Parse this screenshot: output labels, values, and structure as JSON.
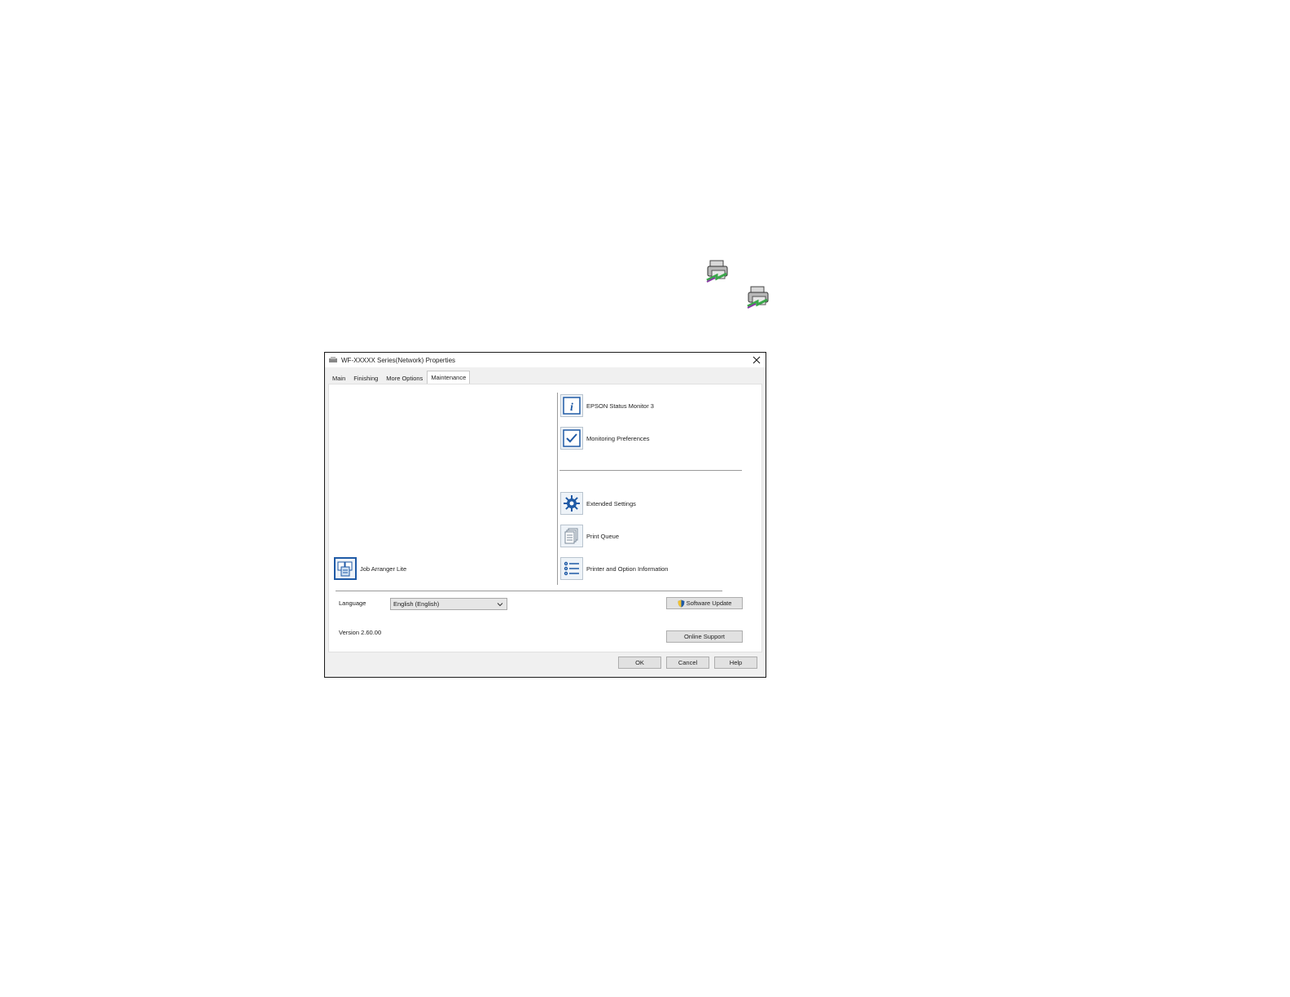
{
  "window": {
    "title": "WF-XXXXX Series(Network) Properties"
  },
  "tabs": [
    {
      "label": "Main"
    },
    {
      "label": "Finishing"
    },
    {
      "label": "More Options"
    },
    {
      "label": "Maintenance",
      "active": true
    }
  ],
  "utilities": {
    "status_monitor": {
      "label": "EPSON Status Monitor 3",
      "icon": "info-icon"
    },
    "monitoring_preferences": {
      "label": "Monitoring Preferences",
      "icon": "checkmark-icon"
    },
    "extended_settings": {
      "label": "Extended Settings",
      "icon": "gear-icon"
    },
    "print_queue": {
      "label": "Print Queue",
      "icon": "document-stack-icon"
    },
    "printer_info": {
      "label": "Printer and Option Information",
      "icon": "list-icon"
    },
    "job_arranger": {
      "label": "Job Arranger Lite",
      "icon": "job-arranger-icon"
    }
  },
  "language": {
    "label": "Language",
    "selected": "English (English)"
  },
  "version": "Version 2.60.00",
  "buttons": {
    "software_update": "Software Update",
    "online_support": "Online Support",
    "ok": "OK",
    "cancel": "Cancel",
    "help": "Help"
  },
  "colors": {
    "accent": "#1f5aa6",
    "panel_bg": "#ffffff",
    "window_bg": "#f0f0f0"
  }
}
